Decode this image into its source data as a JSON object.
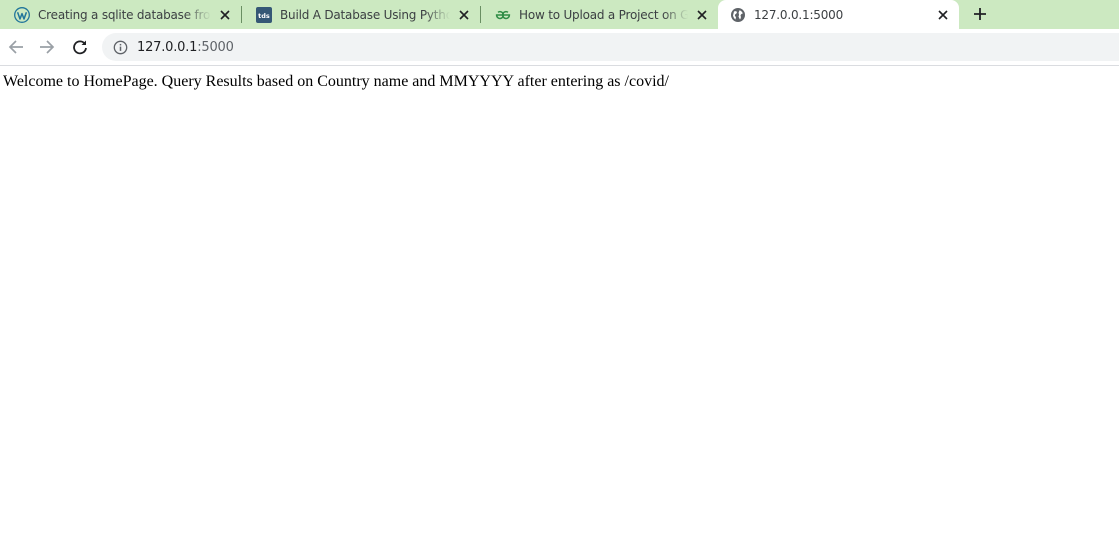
{
  "browser": {
    "tabs": [
      {
        "title": "Creating a sqlite database from C",
        "favicon": "wordpress-icon",
        "active": false
      },
      {
        "title": "Build A Database Using Python |",
        "favicon": "tds-icon",
        "active": false
      },
      {
        "title": "How to Upload a Project on Github",
        "favicon": "geeksforgeeks-icon",
        "active": false
      },
      {
        "title": "127.0.0.1:5000",
        "favicon": "globe-icon",
        "active": true
      }
    ],
    "new_tab_icon": "plus-icon",
    "tds_favicon_text": "tds",
    "colors": {
      "tab_strip": "#cce9c1",
      "active_tab": "#ffffff",
      "omnibox": "#f1f3f4"
    }
  },
  "toolbar": {
    "back_icon": "back-arrow-icon",
    "forward_icon": "forward-arrow-icon",
    "reload_icon": "reload-icon",
    "address": {
      "host": "127.0.0.1",
      "port": ":5000",
      "security_icon": "info-icon"
    }
  },
  "page": {
    "body_text": "Welcome to HomePage. Query Results based on Country name and MMYYYY after entering as /covid/"
  }
}
